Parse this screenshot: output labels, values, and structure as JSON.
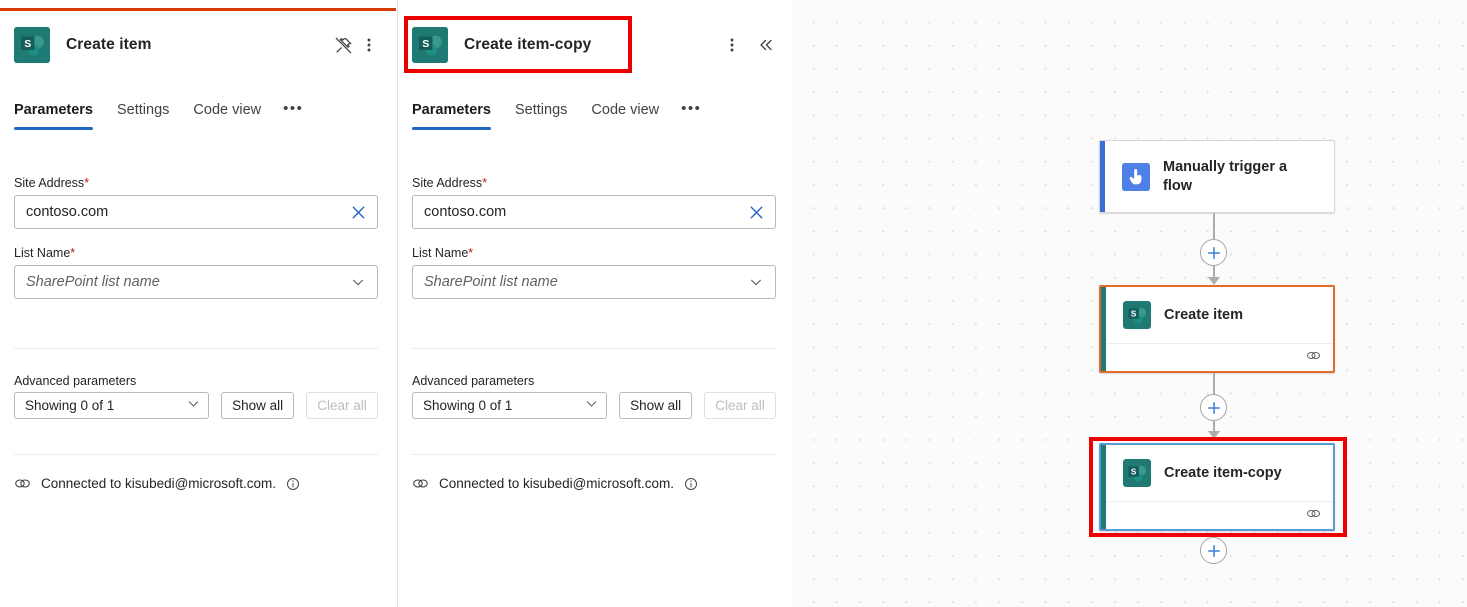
{
  "panels": [
    {
      "id": "create-item",
      "icon_name": "sharepoint-icon",
      "title": "Create item",
      "header_actions": [
        {
          "name": "unpin-icon",
          "label": "Unpin"
        },
        {
          "name": "more-options-icon",
          "label": "More commands"
        }
      ],
      "tabs": [
        {
          "label": "Parameters",
          "active": true
        },
        {
          "label": "Settings",
          "active": false
        },
        {
          "label": "Code view",
          "active": false
        }
      ],
      "tabs_overflow": "•••",
      "fields": [
        {
          "label": "Site Address",
          "required": true,
          "required_marker": "*",
          "value": "contoso.com",
          "is_placeholder": false,
          "affix_icon": "clear-x-icon"
        },
        {
          "label": "List Name",
          "required": true,
          "required_marker": "*",
          "value": "SharePoint list name",
          "is_placeholder": true,
          "affix_icon": "chevron-down-icon"
        }
      ],
      "advanced": {
        "label": "Advanced parameters",
        "select_value": "Showing 0 of 1",
        "show_all_label": "Show all",
        "clear_all_label": "Clear all",
        "clear_all_disabled": true
      },
      "connection": {
        "icon_name": "connection-link-icon",
        "text": "Connected to kisubedi@microsoft.com.",
        "info_icon": "info-icon"
      }
    },
    {
      "id": "create-item-copy",
      "icon_name": "sharepoint-icon",
      "title": "Create item-copy",
      "header_actions": [
        {
          "name": "more-options-icon",
          "label": "More commands"
        },
        {
          "name": "collapse-chevrons-icon",
          "label": "Collapse"
        }
      ],
      "tabs": [
        {
          "label": "Parameters",
          "active": true
        },
        {
          "label": "Settings",
          "active": false
        },
        {
          "label": "Code view",
          "active": false
        }
      ],
      "tabs_overflow": "•••",
      "fields": [
        {
          "label": "Site Address",
          "required": true,
          "required_marker": "*",
          "value": "contoso.com",
          "is_placeholder": false,
          "affix_icon": "clear-x-icon"
        },
        {
          "label": "List Name",
          "required": true,
          "required_marker": "*",
          "value": "SharePoint list name",
          "is_placeholder": true,
          "affix_icon": "chevron-down-icon"
        }
      ],
      "advanced": {
        "label": "Advanced parameters",
        "select_value": "Showing 0 of 1",
        "show_all_label": "Show all",
        "clear_all_label": "Clear all",
        "clear_all_disabled": true
      },
      "connection": {
        "icon_name": "connection-link-icon",
        "text": "Connected to kisubedi@microsoft.com.",
        "info_icon": "info-icon"
      }
    }
  ],
  "canvas": {
    "nodes": [
      {
        "id": "trigger",
        "title": "Manually trigger a flow",
        "icon_name": "manual-trigger-icon",
        "accent_color": "#3b6fd4",
        "border_state": "default",
        "has_footer": false
      },
      {
        "id": "create-item",
        "title": "Create item",
        "icon_name": "sharepoint-icon",
        "accent_color": "#1f7a74",
        "border_state": "selected-orange",
        "has_footer": true,
        "footer_icon": "connection-link-icon"
      },
      {
        "id": "create-item-copy",
        "title": "Create item-copy",
        "icon_name": "sharepoint-icon",
        "accent_color": "#1f7a74",
        "border_state": "focused-blue",
        "has_footer": true,
        "footer_icon": "connection-link-icon"
      }
    ],
    "add_buttons": [
      {
        "name": "add-step-button-1",
        "icon": "plus-icon"
      },
      {
        "name": "add-step-button-2",
        "icon": "plus-icon"
      },
      {
        "name": "add-step-button-3",
        "icon": "plus-icon"
      }
    ]
  },
  "annotations": [
    {
      "name": "highlight-panel-header",
      "color": "#ec0000"
    },
    {
      "name": "highlight-canvas-node",
      "color": "#ec0000"
    }
  ],
  "colors": {
    "accent_blue": "#2266c6",
    "sharepoint_teal": "#1f7a74",
    "selected_orange": "#e36c2c",
    "focus_blue": "#5b9bd5",
    "annotation_red": "#ec0000",
    "required_red": "#b62020"
  }
}
